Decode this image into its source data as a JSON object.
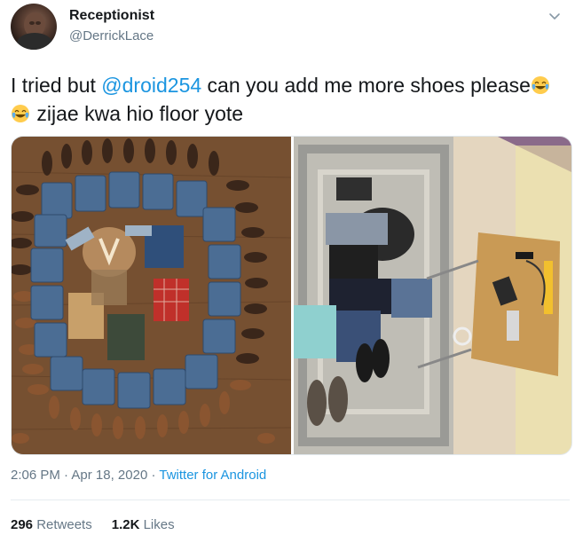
{
  "user": {
    "display_name": "Receptionist",
    "handle": "@DerrickLace"
  },
  "tweet": {
    "text_part1": "I tried but ",
    "mention": "@droid254",
    "text_part2": " can you add me more shoes please",
    "emojis": [
      "face-with-tears-of-joy",
      "face-with-tears-of-joy"
    ],
    "text_part3": " zijae kwa hio floor yote"
  },
  "meta": {
    "time": "2:06 PM",
    "separator": " · ",
    "date": "Apr 18, 2020",
    "source": "Twitter for Android"
  },
  "stats": {
    "retweets_count": "296",
    "retweets_label": " Retweets",
    "likes_count": "1.2K",
    "likes_label": " Likes"
  },
  "colors": {
    "link": "#1b95e0",
    "secondary_text": "#657786",
    "primary_text": "#14171a"
  }
}
